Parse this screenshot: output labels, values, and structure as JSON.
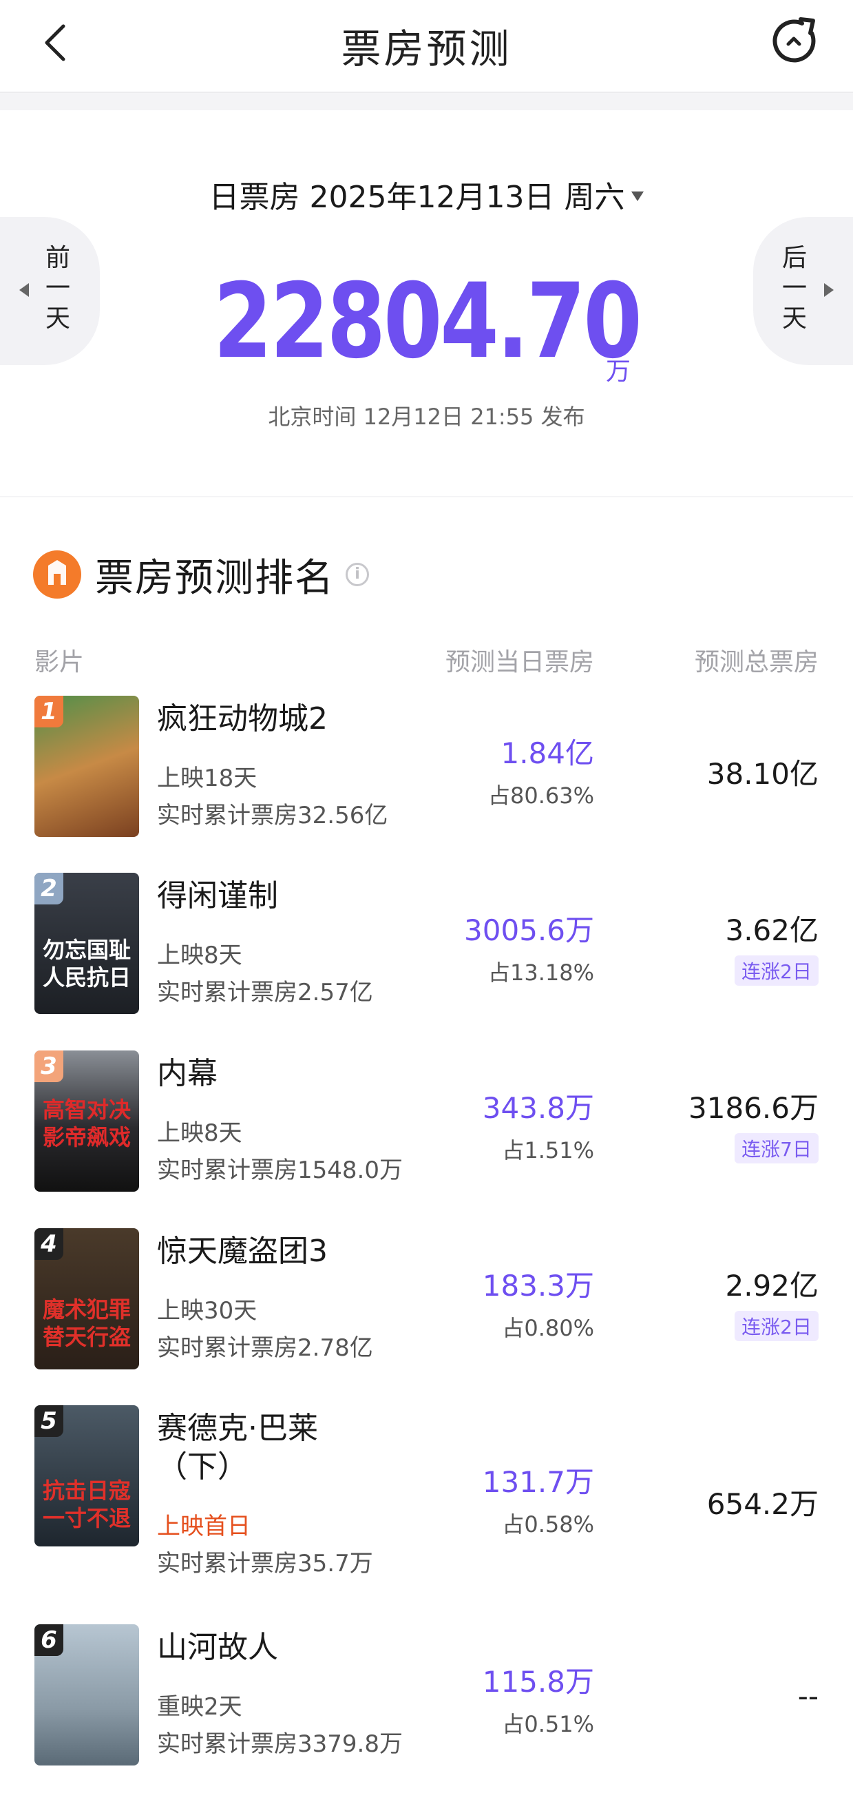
{
  "header": {
    "title": "票房预测"
  },
  "hero": {
    "date_line": "日票房 2025年12月13日 周六",
    "prev_label": [
      "前",
      "一",
      "天"
    ],
    "next_label": [
      "后",
      "一",
      "天"
    ],
    "total": "22804.70",
    "unit": "万",
    "publish": "北京时间 12月12日 21:55 发布"
  },
  "ranking": {
    "title": "票房预测排名",
    "columns": {
      "film": "影片",
      "day": "预测当日票房",
      "total": "预测总票房"
    },
    "rows": [
      {
        "rank": "1",
        "name": "疯狂动物城2",
        "days": "上映18天",
        "cum": "实时累计票房32.56亿",
        "day": "1.84亿",
        "share": "占80.63%",
        "total": "38.10亿",
        "streak": "",
        "poster_text": "",
        "badge_color": "#f07a3c"
      },
      {
        "rank": "2",
        "name": "得闲谨制",
        "days": "上映8天",
        "cum": "实时累计票房2.57亿",
        "day": "3005.6万",
        "share": "占13.18%",
        "total": "3.62亿",
        "streak": "连涨2日",
        "poster_text": "勿忘国耻 人民抗日",
        "badge_color": "#8fa6c2"
      },
      {
        "rank": "3",
        "name": "内幕",
        "days": "上映8天",
        "cum": "实时累计票房1548.0万",
        "day": "343.8万",
        "share": "占1.51%",
        "total": "3186.6万",
        "streak": "连涨7日",
        "poster_text": "高智对决 影帝飙戏",
        "badge_color": "#f3a47a"
      },
      {
        "rank": "4",
        "name": "惊天魔盗团3",
        "days": "上映30天",
        "cum": "实时累计票房2.78亿",
        "day": "183.3万",
        "share": "占0.80%",
        "total": "2.92亿",
        "streak": "连涨2日",
        "poster_text": "魔术犯罪 替天行盗",
        "badge_color": "#222222"
      },
      {
        "rank": "5",
        "name": "赛德克·巴莱（下）",
        "days": "上映首日",
        "cum": "实时累计票房35.7万",
        "day": "131.7万",
        "share": "占0.58%",
        "total": "654.2万",
        "streak": "",
        "poster_text": "抗击日寇 一寸不退",
        "badge_color": "#222222"
      },
      {
        "rank": "6",
        "name": "山河故人",
        "days": "重映2天",
        "cum": "实时累计票房3379.8万",
        "day": "115.8万",
        "share": "占0.51%",
        "total": "--",
        "streak": "",
        "poster_text": "",
        "badge_color": "#222222"
      }
    ]
  }
}
